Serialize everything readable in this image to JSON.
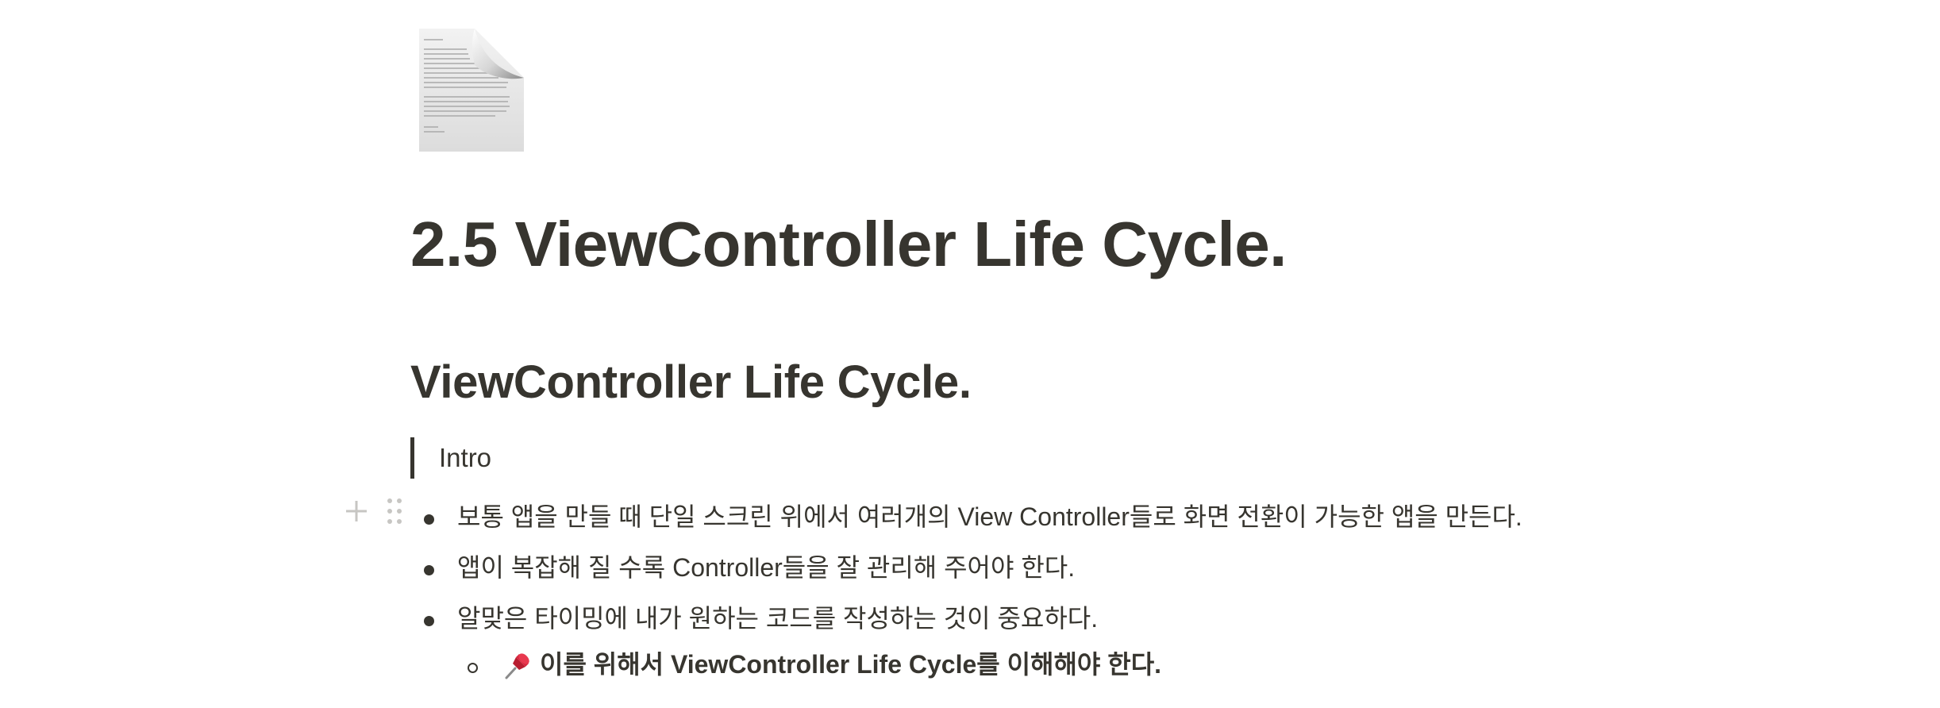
{
  "page": {
    "icon": "document-icon",
    "title": "2.5 ViewController Life Cycle."
  },
  "heading": "ViewController Life Cycle.",
  "quote": "Intro",
  "block_handle": {
    "add_icon": "plus-icon",
    "drag_icon": "drag-handle-icon"
  },
  "bullets": [
    {
      "text": "보통 앱을 만들 때 단일 스크린 위에서 여러개의 View Controller들로 화면 전환이 가능한 앱을 만든다."
    },
    {
      "text": "앱이 복잡해 질 수록 Controller들을 잘 관리해 주어야 한다."
    },
    {
      "text": "알맞은 타이밍에 내가 원하는 코드를 작성하는 것이 중요하다."
    }
  ],
  "sub_bullets": [
    {
      "icon": "pushpin-icon",
      "text": "이를 위해서 ViewController Life Cycle를 이해해야 한다."
    }
  ],
  "colors": {
    "text": "#37352f",
    "handle": "#c7c6c3",
    "pin": "#d7263d"
  }
}
